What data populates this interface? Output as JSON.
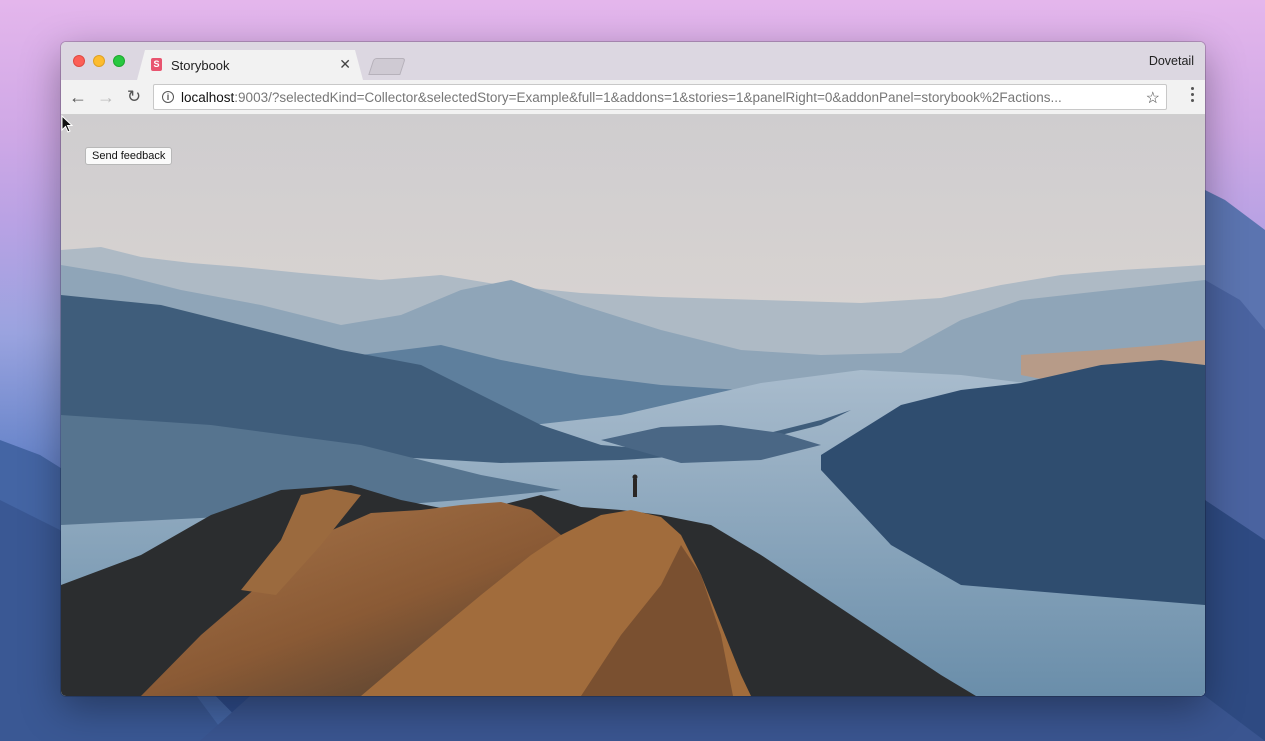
{
  "browser": {
    "tab": {
      "title": "Storybook",
      "icon": "storybook-icon"
    },
    "profile_name": "Dovetail",
    "address": {
      "host": "localhost",
      "rest": ":9003/?selectedKind=Collector&selectedStory=Example&full=1&addons=1&stories=1&panelRight=0&addonPanel=storybook%2Factions..."
    }
  },
  "page": {
    "feedback_button": "Send feedback",
    "background": "mountain-lake-landscape-photo"
  },
  "colors": {
    "traffic_close": "#fc5f57",
    "traffic_min": "#fdbc2e",
    "traffic_max": "#28c840",
    "storybook_brand": "#e8546f"
  }
}
